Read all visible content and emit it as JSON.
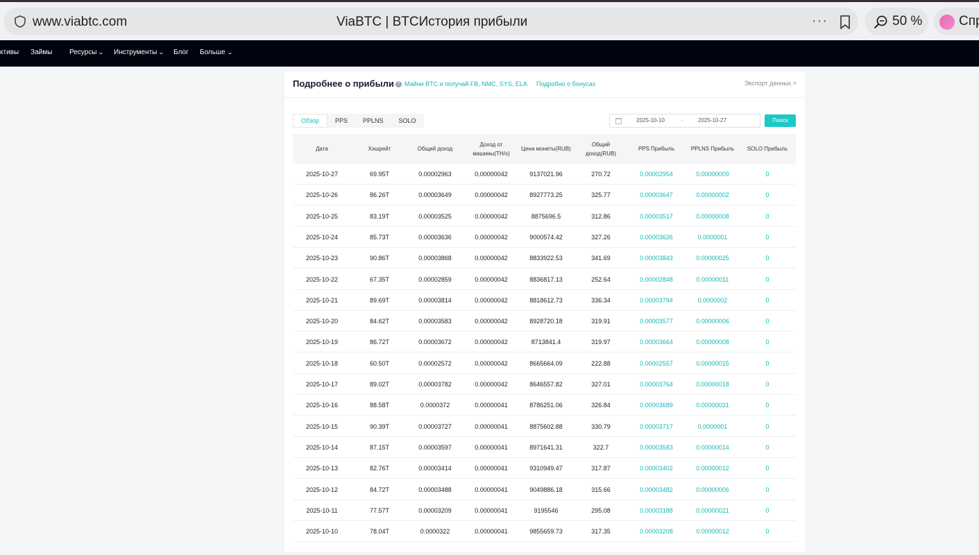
{
  "browser": {
    "url": "www.viabtc.com",
    "title": "ViaBTC | BTCИстория прибыли",
    "menu_dots": "···",
    "zoom": "50 %",
    "assistant_label": "Спр"
  },
  "nav": {
    "items": [
      {
        "label": "ктивы",
        "has_menu": false
      },
      {
        "label": "Займы",
        "has_menu": false
      },
      {
        "label": "Ресурсы",
        "has_menu": true
      },
      {
        "label": "Инструменты",
        "has_menu": true
      },
      {
        "label": "Блог",
        "has_menu": false
      },
      {
        "label": "Больше",
        "has_menu": true
      }
    ]
  },
  "card": {
    "title": "Подробнее о прибыли",
    "promo": "Майни BTC и получай FB, NMC, SYS, ELA",
    "bonus_link": "Подробно о бонусах",
    "export": "Экспорт данных >"
  },
  "tabs": [
    "Обзор",
    "PPS",
    "PPLNS",
    "SOLO"
  ],
  "active_tab": "Обзор",
  "filter": {
    "date_from": "2025-10-10",
    "separator": "-",
    "date_to": "2025-10-27",
    "search_label": "Поиск"
  },
  "table": {
    "headers": [
      "Дата",
      "Хэшрейт",
      "Общий доход",
      "Доход от машины(TH/s)",
      "Цена монеты(RUB)",
      "Общий доход(RUB)",
      "PPS Прибыль",
      "PPLNS Прибыль",
      "SOLO Прибыль"
    ],
    "rows": [
      [
        "2025-10-27",
        "69.95T",
        "0.00002963",
        "0.00000042",
        "9137021.96",
        "270.72",
        "0.00002954",
        "0.00000009",
        "0"
      ],
      [
        "2025-10-26",
        "86.26T",
        "0.00003649",
        "0.00000042",
        "8927773.25",
        "325.77",
        "0.00003647",
        "0.00000002",
        "0"
      ],
      [
        "2025-10-25",
        "83.19T",
        "0.00003525",
        "0.00000042",
        "8875696.5",
        "312.86",
        "0.00003517",
        "0.00000008",
        "0"
      ],
      [
        "2025-10-24",
        "85.73T",
        "0.00003636",
        "0.00000042",
        "9000574.42",
        "327.26",
        "0.00003626",
        "0.0000001",
        "0"
      ],
      [
        "2025-10-23",
        "90.86T",
        "0.00003868",
        "0.00000042",
        "8833922.53",
        "341.69",
        "0.00003843",
        "0.00000025",
        "0"
      ],
      [
        "2025-10-22",
        "67.35T",
        "0.00002859",
        "0.00000042",
        "8836817.13",
        "252.64",
        "0.00002848",
        "0.00000011",
        "0"
      ],
      [
        "2025-10-21",
        "89.69T",
        "0.00003814",
        "0.00000042",
        "8818612.73",
        "336.34",
        "0.00003794",
        "0.0000002",
        "0"
      ],
      [
        "2025-10-20",
        "84.62T",
        "0.00003583",
        "0.00000042",
        "8928720.18",
        "319.91",
        "0.00003577",
        "0.00000006",
        "0"
      ],
      [
        "2025-10-19",
        "86.72T",
        "0.00003672",
        "0.00000042",
        "8713841.4",
        "319.97",
        "0.00003664",
        "0.00000008",
        "0"
      ],
      [
        "2025-10-18",
        "60.50T",
        "0.00002572",
        "0.00000042",
        "8665664.09",
        "222.88",
        "0.00002557",
        "0.00000015",
        "0"
      ],
      [
        "2025-10-17",
        "89.02T",
        "0.00003782",
        "0.00000042",
        "8646557.82",
        "327.01",
        "0.00003764",
        "0.00000018",
        "0"
      ],
      [
        "2025-10-16",
        "88.58T",
        "0.0000372",
        "0.00000041",
        "8786251.06",
        "326.84",
        "0.00003689",
        "0.00000031",
        "0"
      ],
      [
        "2025-10-15",
        "90.39T",
        "0.00003727",
        "0.00000041",
        "8875602.88",
        "330.79",
        "0.00003717",
        "0.0000001",
        "0"
      ],
      [
        "2025-10-14",
        "87.15T",
        "0.00003597",
        "0.00000041",
        "8971641.31",
        "322.7",
        "0.00003583",
        "0.00000014",
        "0"
      ],
      [
        "2025-10-13",
        "82.76T",
        "0.00003414",
        "0.00000041",
        "9310949.47",
        "317.87",
        "0.00003402",
        "0.00000012",
        "0"
      ],
      [
        "2025-10-12",
        "84.72T",
        "0.00003488",
        "0.00000041",
        "9049886.18",
        "315.66",
        "0.00003482",
        "0.00000006",
        "0"
      ],
      [
        "2025-10-11",
        "77.57T",
        "0.00003209",
        "0.00000041",
        "9195546",
        "295.08",
        "0.00003188",
        "0.00000021",
        "0"
      ],
      [
        "2025-10-10",
        "78.04T",
        "0.0000322",
        "0.00000041",
        "9855659.73",
        "317.35",
        "0.00003208",
        "0.00000012",
        "0"
      ]
    ]
  },
  "colors": {
    "accent": "#12b8b8",
    "button": "#1cc8c8",
    "nav_bg": "#00040e"
  }
}
